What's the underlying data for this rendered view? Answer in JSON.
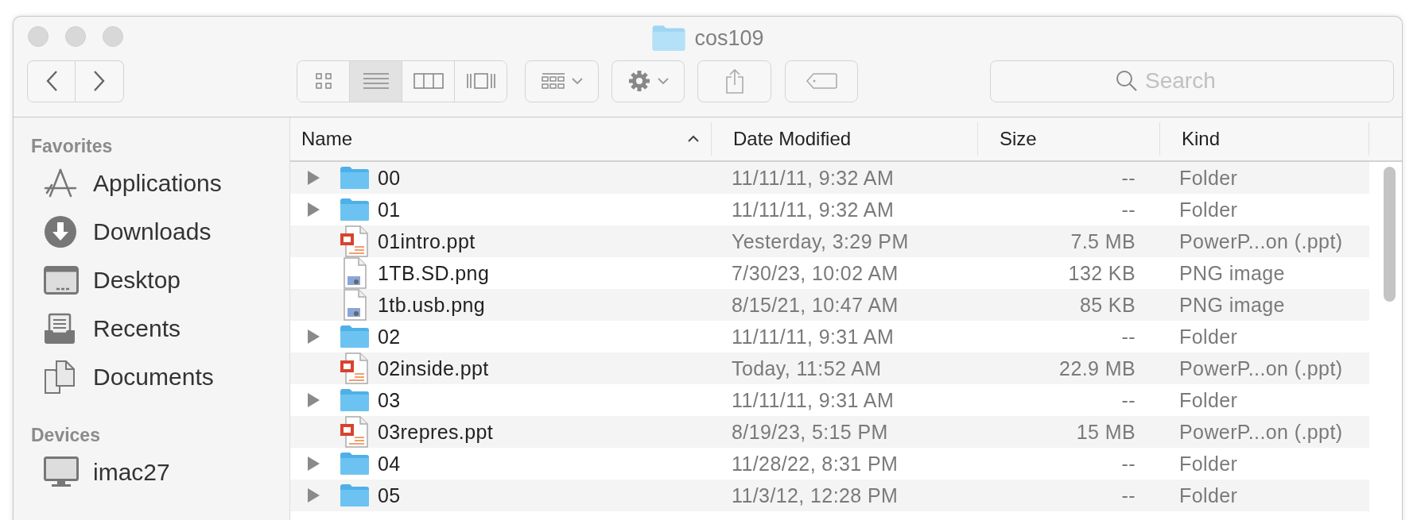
{
  "window": {
    "title": "cos109"
  },
  "toolbar": {
    "view_modes": [
      {
        "kind": "icons",
        "selected": false
      },
      {
        "kind": "list",
        "selected": true
      },
      {
        "kind": "columns",
        "selected": false
      },
      {
        "kind": "gallery",
        "selected": false
      }
    ],
    "search": {
      "placeholder": "Search"
    }
  },
  "sidebar": {
    "sections": [
      {
        "heading": "Favorites",
        "items": [
          {
            "label": "Applications",
            "kind": "applications",
            "selected": false
          },
          {
            "label": "Downloads",
            "kind": "downloads",
            "selected": false
          },
          {
            "label": "Desktop",
            "kind": "desktop",
            "selected": false
          },
          {
            "label": "Recents",
            "kind": "recents",
            "selected": false
          },
          {
            "label": "Documents",
            "kind": "documents",
            "selected": false
          }
        ]
      },
      {
        "heading": "Devices",
        "items": [
          {
            "label": "imac27",
            "kind": "computer",
            "selected": false
          }
        ]
      }
    ]
  },
  "table": {
    "columns": [
      {
        "label": "Name",
        "sorted": true
      },
      {
        "label": "Date Modified"
      },
      {
        "label": "Size"
      },
      {
        "label": "Kind"
      }
    ],
    "rows": [
      {
        "name": "00",
        "date": "11/11/11, 9:32 AM",
        "size": "--",
        "kind_text": "Folder",
        "kind": "folder",
        "expanded": false
      },
      {
        "name": "01",
        "date": "11/11/11, 9:32 AM",
        "size": "--",
        "kind_text": "Folder",
        "kind": "folder",
        "expanded": false
      },
      {
        "name": "01intro.ppt",
        "date": "Yesterday, 3:29 PM",
        "size": "7.5 MB",
        "kind_text": "PowerP...on (.ppt)",
        "kind": "presentation"
      },
      {
        "name": "1TB.SD.png",
        "date": "7/30/23, 10:02 AM",
        "size": "132 KB",
        "kind_text": "PNG image",
        "kind": "image"
      },
      {
        "name": "1tb.usb.png",
        "date": "8/15/21, 10:47 AM",
        "size": "85 KB",
        "kind_text": "PNG image",
        "kind": "image"
      },
      {
        "name": "02",
        "date": "11/11/11, 9:31 AM",
        "size": "--",
        "kind_text": "Folder",
        "kind": "folder",
        "expanded": false
      },
      {
        "name": "02inside.ppt",
        "date": "Today, 11:52 AM",
        "size": "22.9 MB",
        "kind_text": "PowerP...on (.ppt)",
        "kind": "presentation"
      },
      {
        "name": "03",
        "date": "11/11/11, 9:31 AM",
        "size": "--",
        "kind_text": "Folder",
        "kind": "folder",
        "expanded": false
      },
      {
        "name": "03repres.ppt",
        "date": "8/19/23, 5:15 PM",
        "size": "15 MB",
        "kind_text": "PowerP...on (.ppt)",
        "kind": "presentation"
      },
      {
        "name": "04",
        "date": "11/28/22, 8:31 PM",
        "size": "--",
        "kind_text": "Folder",
        "kind": "folder",
        "expanded": false
      },
      {
        "name": "05",
        "date": "11/3/12, 12:28 PM",
        "size": "--",
        "kind_text": "Folder",
        "kind": "folder",
        "expanded": false
      }
    ]
  }
}
